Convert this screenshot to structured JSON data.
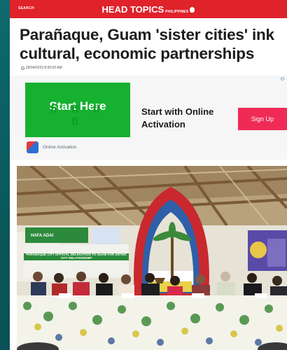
{
  "header": {
    "search_label": "SEARCH",
    "brand": "HEAD TOPICS",
    "brand_region": "PHILIPPINES",
    "accent_color": "#e0222b"
  },
  "article": {
    "title": "Parañaque, Guam 'sister cities' ink cultural, economic partnerships",
    "date": "29/04/2023 8:00:00 AM"
  },
  "ad": {
    "banner_title": "Start Here",
    "banner_ghost": "ﬁ ﬂ ﬂ ﬂ",
    "text": "Start with Online Activation",
    "cta": "Sign Up",
    "advertiser": "Online Activation"
  },
  "photo": {
    "banner_left_small": "HAFA ADAI",
    "banner_main": "PARAÑAQUE CITY OFFICIAL DELEGATION TO GUAM FOR SISTER CITY RELATIONSHIP"
  }
}
